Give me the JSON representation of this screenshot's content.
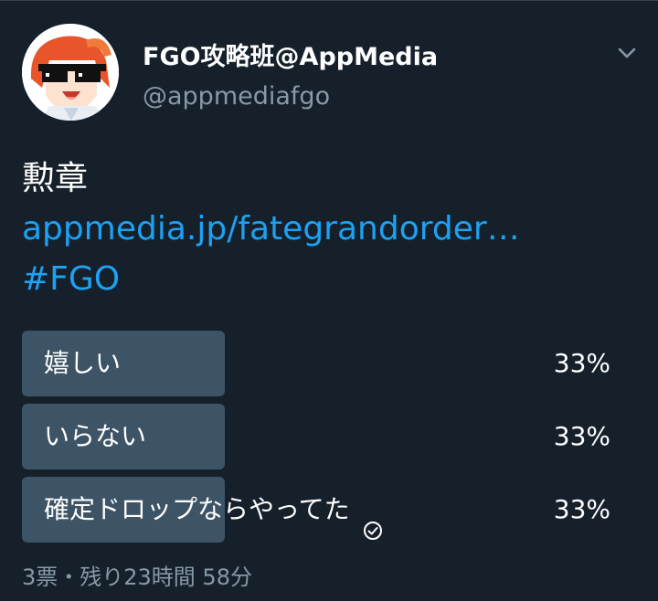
{
  "author": {
    "display_name": "FGO攻略班@AppMedia",
    "handle": "@appmediafgo",
    "avatar_icon": "avatar-anime-character-sunglasses"
  },
  "menu_icon": "chevron-down-icon",
  "tweet": {
    "text": "勲章",
    "link": "appmedia.jp/fategrandorder…",
    "hashtag": "#FGO"
  },
  "poll": {
    "options": [
      {
        "label": "嬉しい",
        "percent_text": "33%",
        "share": 0.33,
        "selected": false
      },
      {
        "label": "いらない",
        "percent_text": "33%",
        "share": 0.33,
        "selected": false
      },
      {
        "label": "確定ドロップならやってた",
        "percent_text": "33%",
        "share": 0.33,
        "selected": true
      }
    ],
    "meta": "3票・残り23時間 58分"
  },
  "colors": {
    "background": "#15202b",
    "link": "#1da1f2",
    "bar": "#3d5466",
    "muted": "#8899a6"
  }
}
